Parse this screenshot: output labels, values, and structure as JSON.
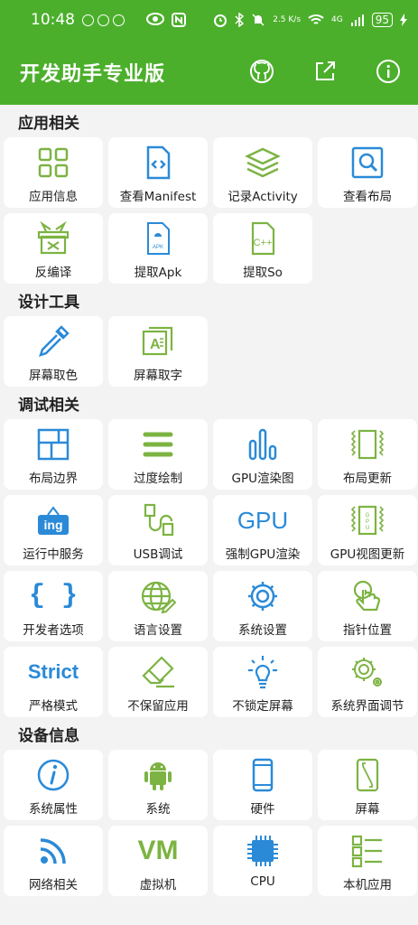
{
  "status_bar": {
    "time": "10:48",
    "speed": "2.5 K/s",
    "network": "4G",
    "battery": "95"
  },
  "app": {
    "title": "开发助手专业版"
  },
  "sections": [
    {
      "title": "应用相关",
      "items": [
        {
          "label": "应用信息",
          "icon": "grid-icon"
        },
        {
          "label": "查看Manifest",
          "icon": "code-file-icon"
        },
        {
          "label": "记录Activity",
          "icon": "layers-icon"
        },
        {
          "label": "查看布局",
          "icon": "search-layout-icon"
        },
        {
          "label": "反编译",
          "icon": "box-icon"
        },
        {
          "label": "提取Apk",
          "icon": "apk-file-icon"
        },
        {
          "label": "提取So",
          "icon": "cpp-file-icon"
        }
      ]
    },
    {
      "title": "设计工具",
      "items": [
        {
          "label": "屏幕取色",
          "icon": "eyedropper-icon"
        },
        {
          "label": "屏幕取字",
          "icon": "text-capture-icon"
        }
      ]
    },
    {
      "title": "调试相关",
      "items": [
        {
          "label": "布局边界",
          "icon": "layout-bounds-icon"
        },
        {
          "label": "过度绘制",
          "icon": "menu-lines-icon"
        },
        {
          "label": "GPU渲染图",
          "icon": "bar-chart-icon"
        },
        {
          "label": "布局更新",
          "icon": "layout-update-icon"
        },
        {
          "label": "运行中服务",
          "icon": "ing-sign-icon"
        },
        {
          "label": "USB调试",
          "icon": "usb-icon"
        },
        {
          "label": "强制GPU渲染",
          "icon": "gpu-text-icon",
          "text": "GPU"
        },
        {
          "label": "GPU视图更新",
          "icon": "gpu-update-icon"
        },
        {
          "label": "开发者选项",
          "icon": "braces-icon",
          "text": "{ }"
        },
        {
          "label": "语言设置",
          "icon": "globe-icon"
        },
        {
          "label": "系统设置",
          "icon": "gear-icon"
        },
        {
          "label": "指针位置",
          "icon": "pointer-icon"
        },
        {
          "label": "严格模式",
          "icon": "strict-text-icon",
          "text": "Strict"
        },
        {
          "label": "不保留应用",
          "icon": "eraser-icon"
        },
        {
          "label": "不锁定屏幕",
          "icon": "bulb-icon"
        },
        {
          "label": "系统界面调节",
          "icon": "gears-icon"
        }
      ]
    },
    {
      "title": "设备信息",
      "items": [
        {
          "label": "系统属性",
          "icon": "info-icon"
        },
        {
          "label": "系统",
          "icon": "android-icon"
        },
        {
          "label": "硬件",
          "icon": "phone-icon"
        },
        {
          "label": "屏幕",
          "icon": "screen-icon"
        },
        {
          "label": "网络相关",
          "icon": "rss-icon"
        },
        {
          "label": "虚拟机",
          "icon": "vm-text-icon",
          "text": "VM"
        },
        {
          "label": "CPU",
          "icon": "cpu-icon"
        },
        {
          "label": "本机应用",
          "icon": "app-list-icon"
        }
      ]
    }
  ]
}
